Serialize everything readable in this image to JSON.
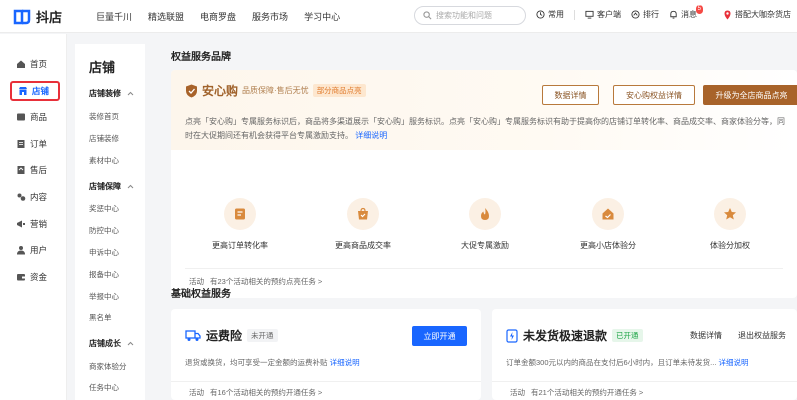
{
  "app": {
    "name": "抖店"
  },
  "topnav": [
    "巨量千川",
    "精选联盟",
    "电商罗盘",
    "服务市场",
    "学习中心"
  ],
  "search": {
    "placeholder": "搜索功能和问题"
  },
  "tools": {
    "common": "常用",
    "service": "客户端",
    "queue": "排行",
    "messages": "消息",
    "message_count": "5"
  },
  "account": {
    "name": "搭配大咖杂货店"
  },
  "sidebar": {
    "items": [
      {
        "label": "首页",
        "icon": "home-icon"
      },
      {
        "label": "店铺",
        "icon": "store-icon"
      },
      {
        "label": "商品",
        "icon": "goods-icon"
      },
      {
        "label": "订单",
        "icon": "order-icon"
      },
      {
        "label": "售后",
        "icon": "aftersale-icon"
      },
      {
        "label": "内容",
        "icon": "content-icon"
      },
      {
        "label": "营销",
        "icon": "marketing-icon"
      },
      {
        "label": "用户",
        "icon": "user-icon"
      },
      {
        "label": "资金",
        "icon": "wallet-icon"
      }
    ]
  },
  "subnav": {
    "title": "店铺",
    "groups": [
      {
        "label": "店铺装修",
        "links": [
          "装修首页",
          "店铺装修",
          "素材中心"
        ]
      },
      {
        "label": "店铺保障",
        "links": [
          "奖惩中心",
          "防控中心",
          "申诉中心",
          "报备中心",
          "举报中心",
          "黑名单"
        ]
      },
      {
        "label": "店铺成长",
        "links": [
          "商家体验分",
          "任务中心"
        ]
      }
    ]
  },
  "brand_section": {
    "title": "权益服务品牌",
    "logo_name": "安心购",
    "logo_sub": "品质保障·售后无忧",
    "tag": "部分商品点亮",
    "buttons": {
      "data": "数据详情",
      "detail": "安心购权益详情",
      "upgrade": "升级为全店商品点亮"
    },
    "desc": "点亮「安心购」专属服务标识后，商品将多渠道展示「安心购」服务标识。点亮「安心购」专属服务标识有助于提高你的店铺订单转化率、商品成交率、商家体验分等，同时在大促期间还有机会获得平台专属激励支持。",
    "desc_link": "详细说明",
    "features": [
      {
        "label": "更高订单转化率",
        "icon": "order-conversion-icon"
      },
      {
        "label": "更高商品成交率",
        "icon": "deal-rate-icon"
      },
      {
        "label": "大促专属激励",
        "icon": "flame-icon"
      },
      {
        "label": "更高小店体验分",
        "icon": "shop-score-icon"
      },
      {
        "label": "体验分加权",
        "icon": "star-icon"
      }
    ],
    "activity_label": "活动",
    "activity_text": "有23个活动相关的预约点亮任务 >"
  },
  "basic_section": {
    "title": "基础权益服务",
    "freight": {
      "name": "运费险",
      "status": "未开通",
      "button": "立即开通",
      "desc": "退货或换货，均可享受一定金额的运费补贴",
      "desc_link": "详细说明",
      "activity_label": "活动",
      "activity_text": "有16个活动相关的预约开通任务 >"
    },
    "refund": {
      "name": "未发货极速退款",
      "status": "已开通",
      "link_data": "数据详情",
      "link_exit": "退出权益服务",
      "desc": "订单金额300元以内的商品在支付后6小时内，且订单未待发货...",
      "desc_link": "详细说明",
      "activity_label": "活动",
      "activity_text": "有21个活动相关的预约开通任务 >"
    }
  },
  "colors": {
    "accent": "#1966ff",
    "brand_brown": "#a8632a",
    "highlight": "#e8303a"
  }
}
